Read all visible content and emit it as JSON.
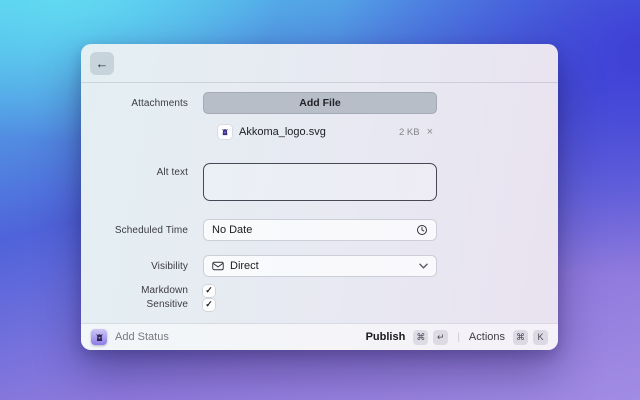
{
  "window": {
    "header": {
      "back_icon": "←"
    },
    "form": {
      "check_icon": "✓",
      "attachments": {
        "label": "Attachments",
        "add_file_button": "Add File",
        "file": {
          "name": "Akkoma_logo.svg",
          "size": "2 KB",
          "remove_icon": "×"
        }
      },
      "alt_text": {
        "label": "Alt text",
        "value": ""
      },
      "scheduled_time": {
        "label": "Scheduled Time",
        "value": "No Date"
      },
      "visibility": {
        "label": "Visibility",
        "value": "Direct"
      },
      "markdown": {
        "label": "Markdown",
        "checked": true
      },
      "sensitive": {
        "label": "Sensitive",
        "checked": true
      }
    },
    "footer": {
      "app_label": "Add Status",
      "publish": {
        "label": "Publish",
        "keys": [
          "⌘",
          "↵"
        ]
      },
      "separator": "|",
      "actions": {
        "label": "Actions",
        "keys": [
          "⌘",
          "K"
        ]
      }
    }
  },
  "colors": {
    "bg_top_left": "#5fd9f1",
    "bg_top_right": "#3e3dd6",
    "bg_bottom": "#9d86e1",
    "brand_purple": "#6a5acd",
    "window_tint": "#e8e9f2"
  }
}
